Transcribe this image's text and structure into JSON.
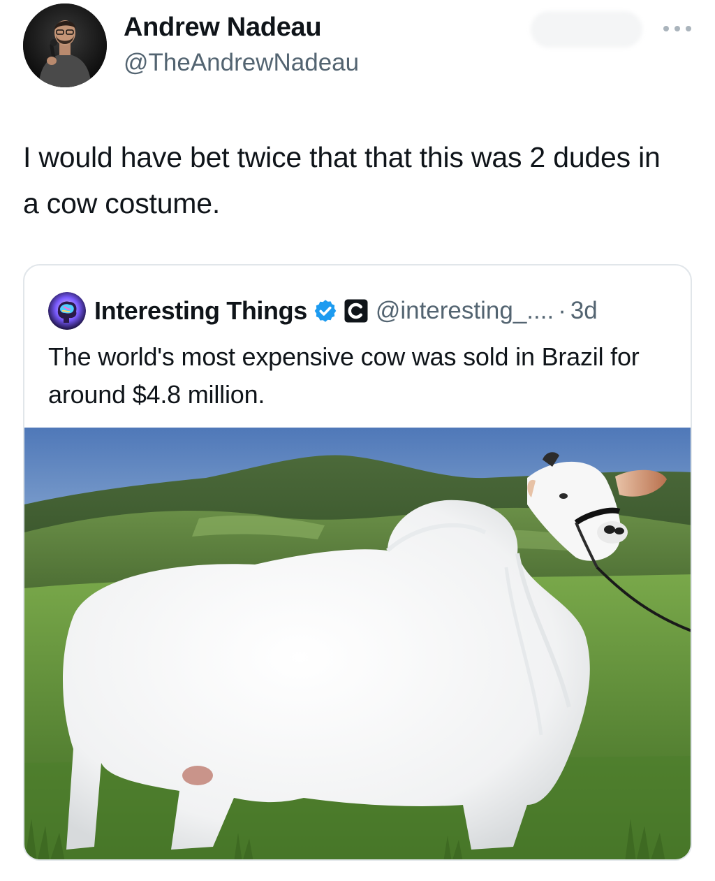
{
  "tweet": {
    "author": {
      "name": "Andrew Nadeau",
      "handle": "@TheAndrewNadeau"
    },
    "text": "I would have bet twice that that this was 2 dudes in a cow costume.",
    "more_icon": "more-horizontal-icon",
    "quoted": {
      "author_name": "Interesting Things",
      "verified_icon": "verified-badge-icon",
      "affiliate_icon": "affiliate-c-icon",
      "handle": "@interesting_....",
      "separator": "·",
      "time": "3d",
      "text": "The world's most expensive cow was sold in Brazil for around $4.8 million.",
      "media_description_icon": "cow-photo"
    }
  },
  "colors": {
    "text_primary": "#0f1419",
    "text_secondary": "#536471",
    "verified_blue": "#1d9bf0",
    "card_border": "#e1e6ea"
  }
}
